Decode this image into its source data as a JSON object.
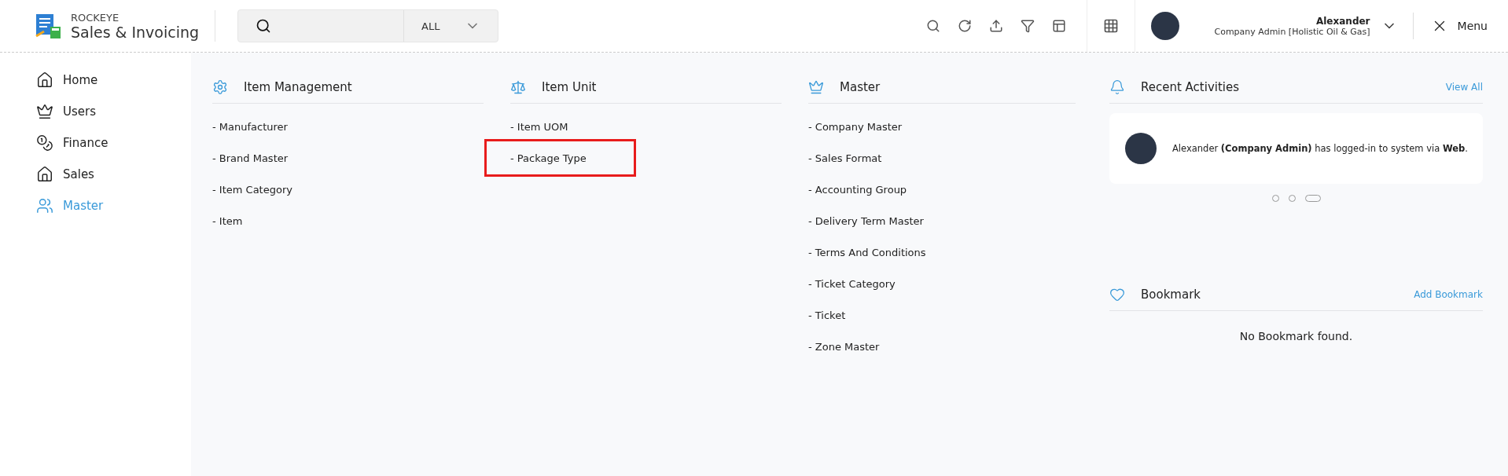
{
  "brand": {
    "company": "ROCKEYE",
    "product": "Sales & Invoicing"
  },
  "search": {
    "scope": "ALL"
  },
  "user": {
    "name": "Alexander",
    "role": "Company Admin [Holistic Oil & Gas]"
  },
  "menu_button": "Menu",
  "sidebar": {
    "items": [
      {
        "label": "Home",
        "selected": false
      },
      {
        "label": "Users",
        "selected": false
      },
      {
        "label": "Finance",
        "selected": false
      },
      {
        "label": "Sales",
        "selected": false
      },
      {
        "label": "Master",
        "selected": true
      }
    ]
  },
  "sections": [
    {
      "title": "Item Management",
      "items": [
        {
          "label": "- Manufacturer",
          "highlighted": false
        },
        {
          "label": "- Brand Master",
          "highlighted": false
        },
        {
          "label": "- Item Category",
          "highlighted": false
        },
        {
          "label": "- Item",
          "highlighted": false
        }
      ]
    },
    {
      "title": "Item Unit",
      "items": [
        {
          "label": "- Item UOM",
          "highlighted": false
        },
        {
          "label": "- Package Type",
          "highlighted": true
        }
      ]
    },
    {
      "title": "Master",
      "items": [
        {
          "label": "- Company Master",
          "highlighted": false
        },
        {
          "label": "- Sales Format",
          "highlighted": false
        },
        {
          "label": "- Accounting Group",
          "highlighted": false
        },
        {
          "label": "- Delivery Term Master",
          "highlighted": false
        },
        {
          "label": "- Terms And Conditions",
          "highlighted": false
        },
        {
          "label": "- Ticket Category",
          "highlighted": false
        },
        {
          "label": "- Ticket",
          "highlighted": false
        },
        {
          "label": "- Zone Master",
          "highlighted": false
        }
      ]
    }
  ],
  "recent_activities": {
    "title": "Recent Activities",
    "link": "View All",
    "activity": "Alexander **(Company Admin)** has logged-in to system via **Web**.",
    "dots": [
      {
        "selected": false
      },
      {
        "selected": false
      },
      {
        "selected": true
      }
    ]
  },
  "bookmark": {
    "title": "Bookmark",
    "link": "Add Bookmark",
    "empty": "No Bookmark found."
  }
}
